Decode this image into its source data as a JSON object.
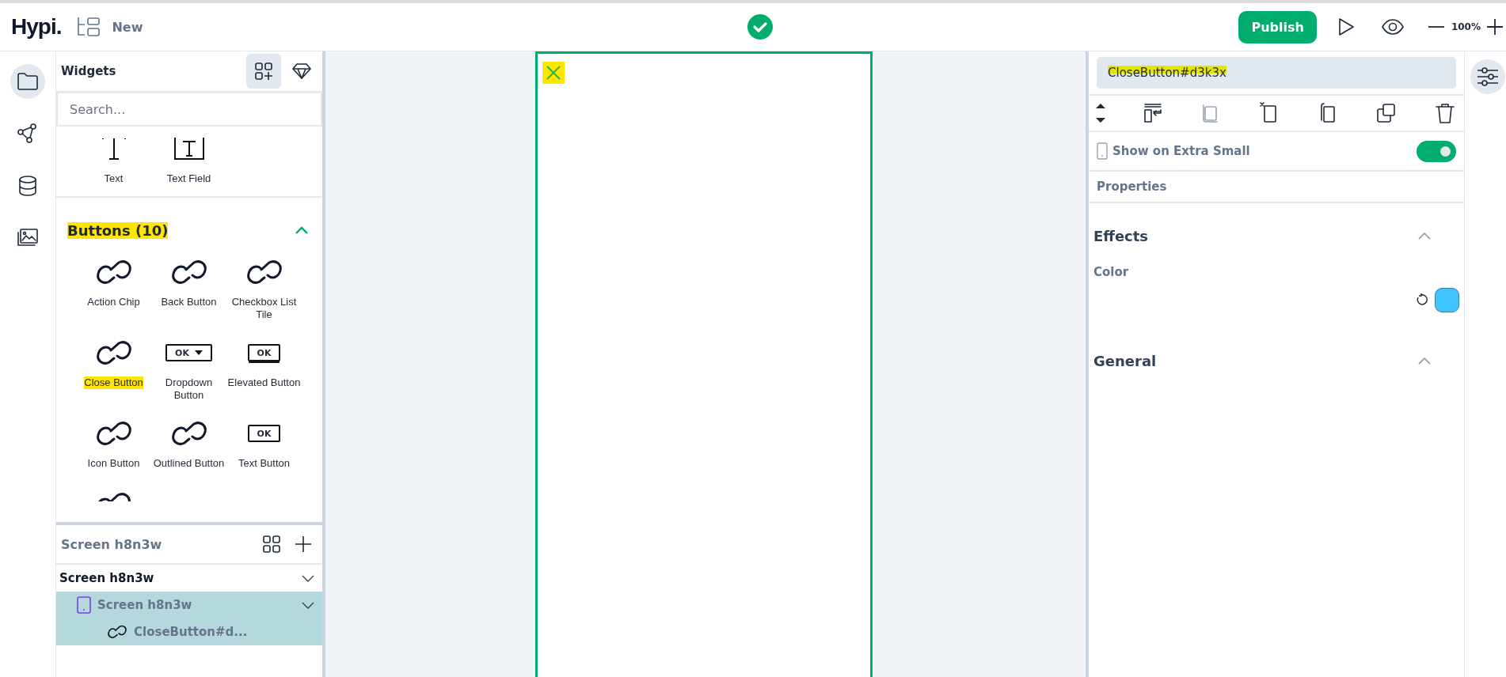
{
  "app": {
    "logo": "Hypi.",
    "project": "New",
    "saved": true
  },
  "toolbar": {
    "publish": "Publish",
    "zoom": "100%"
  },
  "rail": [
    {
      "kind": "folder",
      "selected": true
    },
    {
      "kind": "graph",
      "selected": false
    },
    {
      "kind": "database",
      "selected": false
    },
    {
      "kind": "images",
      "selected": false
    }
  ],
  "widgets_panel": {
    "title": "Widgets",
    "tabs": [
      {
        "kind": "add-widget",
        "selected": true
      },
      {
        "kind": "gem",
        "selected": false
      }
    ],
    "search": {
      "placeholder": "Search..."
    },
    "basic": [
      {
        "label": "Text",
        "kind": "text"
      },
      {
        "label": "Text Field",
        "kind": "text-field"
      }
    ],
    "section": {
      "title": "Buttons (10)",
      "expanded": true,
      "highlighted": true
    },
    "items": [
      {
        "label": "Action Chip",
        "kind": "link",
        "highlighted": false
      },
      {
        "label": "Back Button",
        "kind": "link",
        "highlighted": false
      },
      {
        "label": "Checkbox List Tile",
        "kind": "link",
        "highlighted": false
      },
      {
        "label": "Close Button",
        "kind": "link",
        "highlighted": true
      },
      {
        "label": "Dropdown Button",
        "kind": "dropdown",
        "icon_text": "OK",
        "highlighted": false
      },
      {
        "label": "Elevated Button",
        "kind": "elevated",
        "icon_text": "OK",
        "highlighted": false
      },
      {
        "label": "Icon Button",
        "kind": "link",
        "highlighted": false
      },
      {
        "label": "Outlined Button",
        "kind": "link",
        "highlighted": false
      },
      {
        "label": "Text Button",
        "kind": "outlined",
        "icon_text": "OK",
        "highlighted": false
      }
    ]
  },
  "layers": {
    "title": "Screen h8n3w",
    "tree": [
      {
        "label": "Screen h8n3w",
        "expanded": true,
        "selected": false,
        "children": [
          {
            "label": "Screen h8n3w",
            "kind": "screen",
            "expanded": true,
            "selected": true,
            "children": [
              {
                "label": "CloseButton#d...",
                "kind": "link",
                "selected": true
              }
            ]
          }
        ]
      }
    ]
  },
  "canvas": {
    "widget": {
      "kind": "close",
      "highlighted": true
    }
  },
  "inspector": {
    "name": {
      "value": "CloseButton#d3k3x",
      "highlighted": true
    },
    "actions": [
      {
        "kind": "wrap",
        "disabled": false
      },
      {
        "kind": "duplicate",
        "disabled": true
      },
      {
        "kind": "cut",
        "disabled": false
      },
      {
        "kind": "copy",
        "disabled": false
      },
      {
        "kind": "paste",
        "disabled": false
      },
      {
        "kind": "delete",
        "disabled": false
      }
    ],
    "visibility": {
      "label": "Show on Extra Small",
      "on": true
    },
    "tab": "Properties",
    "sections": [
      {
        "title": "Effects",
        "expanded": true,
        "fields": [
          {
            "label": "Color",
            "color": "#40c4ff"
          }
        ]
      },
      {
        "title": "General",
        "expanded": true
      }
    ]
  }
}
